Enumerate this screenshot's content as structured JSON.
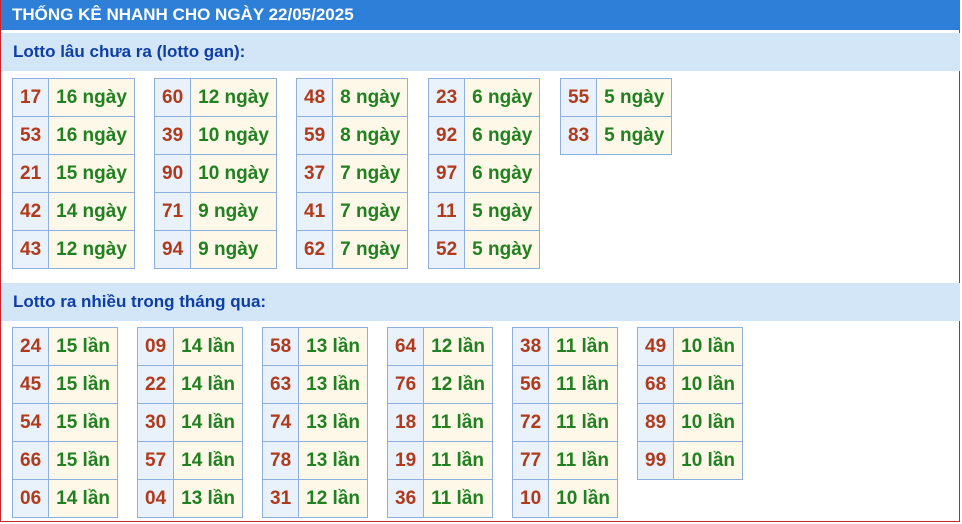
{
  "title": "THỐNG KÊ NHANH CHO NGÀY 22/05/2025",
  "sections": [
    {
      "id": "gan",
      "header": "Lotto lâu chưa ra (lotto gan):",
      "tables": [
        [
          [
            "17",
            "16 ngày"
          ],
          [
            "53",
            "16 ngày"
          ],
          [
            "21",
            "15 ngày"
          ],
          [
            "42",
            "14 ngày"
          ],
          [
            "43",
            "12 ngày"
          ]
        ],
        [
          [
            "60",
            "12 ngày"
          ],
          [
            "39",
            "10 ngày"
          ],
          [
            "90",
            "10 ngày"
          ],
          [
            "71",
            "9 ngày"
          ],
          [
            "94",
            "9 ngày"
          ]
        ],
        [
          [
            "48",
            "8 ngày"
          ],
          [
            "59",
            "8 ngày"
          ],
          [
            "37",
            "7 ngày"
          ],
          [
            "41",
            "7 ngày"
          ],
          [
            "62",
            "7 ngày"
          ]
        ],
        [
          [
            "23",
            "6 ngày"
          ],
          [
            "92",
            "6 ngày"
          ],
          [
            "97",
            "6 ngày"
          ],
          [
            "11",
            "5 ngày"
          ],
          [
            "52",
            "5 ngày"
          ]
        ],
        [
          [
            "55",
            "5 ngày"
          ],
          [
            "83",
            "5 ngày"
          ]
        ]
      ]
    },
    {
      "id": "nhieu",
      "header": "Lotto ra nhiều trong tháng qua:",
      "tables": [
        [
          [
            "24",
            "15 lần"
          ],
          [
            "45",
            "15 lần"
          ],
          [
            "54",
            "15 lần"
          ],
          [
            "66",
            "15 lần"
          ],
          [
            "06",
            "14 lần"
          ]
        ],
        [
          [
            "09",
            "14 lần"
          ],
          [
            "22",
            "14 lần"
          ],
          [
            "30",
            "14 lần"
          ],
          [
            "57",
            "14 lần"
          ],
          [
            "04",
            "13 lần"
          ]
        ],
        [
          [
            "58",
            "13 lần"
          ],
          [
            "63",
            "13 lần"
          ],
          [
            "74",
            "13 lần"
          ],
          [
            "78",
            "13 lần"
          ],
          [
            "31",
            "12 lần"
          ]
        ],
        [
          [
            "64",
            "12 lần"
          ],
          [
            "76",
            "12 lần"
          ],
          [
            "18",
            "11 lần"
          ],
          [
            "19",
            "11 lần"
          ],
          [
            "36",
            "11 lần"
          ]
        ],
        [
          [
            "38",
            "11 lần"
          ],
          [
            "56",
            "11 lần"
          ],
          [
            "72",
            "11 lần"
          ],
          [
            "77",
            "11 lần"
          ],
          [
            "10",
            "10 lần"
          ]
        ],
        [
          [
            "49",
            "10 lần"
          ],
          [
            "68",
            "10 lần"
          ],
          [
            "89",
            "10 lần"
          ],
          [
            "99",
            "10 lần"
          ]
        ]
      ]
    }
  ]
}
